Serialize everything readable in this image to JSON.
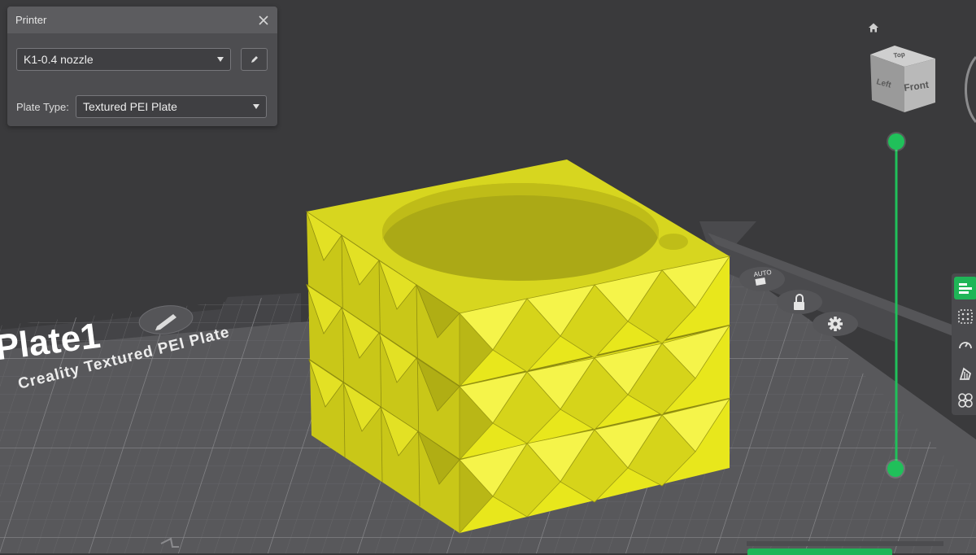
{
  "printer_panel": {
    "title": "Printer",
    "printer_select": {
      "value": "K1-0.4 nozzle"
    },
    "plate_type": {
      "label": "Plate Type:",
      "value": "Textured PEI Plate"
    }
  },
  "plate": {
    "name": "Plate1",
    "bed_label": "Creality Textured PEI Plate"
  },
  "view_cube": {
    "top": "Top",
    "left": "Left",
    "front": "Front"
  },
  "plate_tools": [
    "auto-orient-icon",
    "lock-icon",
    "gear-icon"
  ],
  "right_toolbar": [
    "layers-icon",
    "grid-icon",
    "speed-icon",
    "support-icon",
    "pattern-icon"
  ],
  "colors": {
    "model": "#e6e41e",
    "accent": "#20c05a",
    "panel": "#4d4d50",
    "bed": "#58585b",
    "background": "#3a3a3c"
  }
}
